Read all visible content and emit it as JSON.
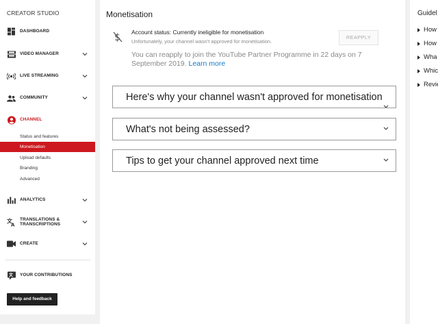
{
  "sidebar": {
    "title": "CREATOR STUDIO",
    "items": [
      {
        "label": "DASHBOARD"
      },
      {
        "label": "VIDEO MANAGER"
      },
      {
        "label": "LIVE STREAMING"
      },
      {
        "label": "COMMUNITY"
      },
      {
        "label": "CHANNEL"
      },
      {
        "label": "ANALYTICS"
      },
      {
        "label": "TRANSLATIONS & TRANSCRIPTIONS"
      },
      {
        "label": "CREATE"
      },
      {
        "label": "YOUR CONTRIBUTIONS"
      }
    ],
    "channel_subitems": [
      {
        "label": "Status and features"
      },
      {
        "label": "Monetisation"
      },
      {
        "label": "Upload defaults"
      },
      {
        "label": "Branding"
      },
      {
        "label": "Advanced"
      }
    ],
    "help_label": "Help and feedback",
    "accent_color": "#cc181e"
  },
  "main": {
    "title": "Monetisation",
    "status_title": "Account status: Currently ineligible for monetisation",
    "status_subtitle": "Unfortunately, your channel wasn't approved for monetisation.",
    "reapply_label": "REAPPLY",
    "reapply_text": "You can reapply to join the YouTube Partner Programme in 22 days on 7 September 2019.",
    "learn_more": "Learn more",
    "link_color": "#167ac6",
    "accordions": [
      {
        "label": "Here's why your channel wasn't approved for monetisation"
      },
      {
        "label": "What's not being assessed?"
      },
      {
        "label": "Tips to get your channel approved next time"
      }
    ]
  },
  "right": {
    "title": "Guidel",
    "items": [
      {
        "label": "How"
      },
      {
        "label": "How"
      },
      {
        "label": "Wha"
      },
      {
        "label": "Whic"
      },
      {
        "label": "Revie"
      }
    ]
  }
}
